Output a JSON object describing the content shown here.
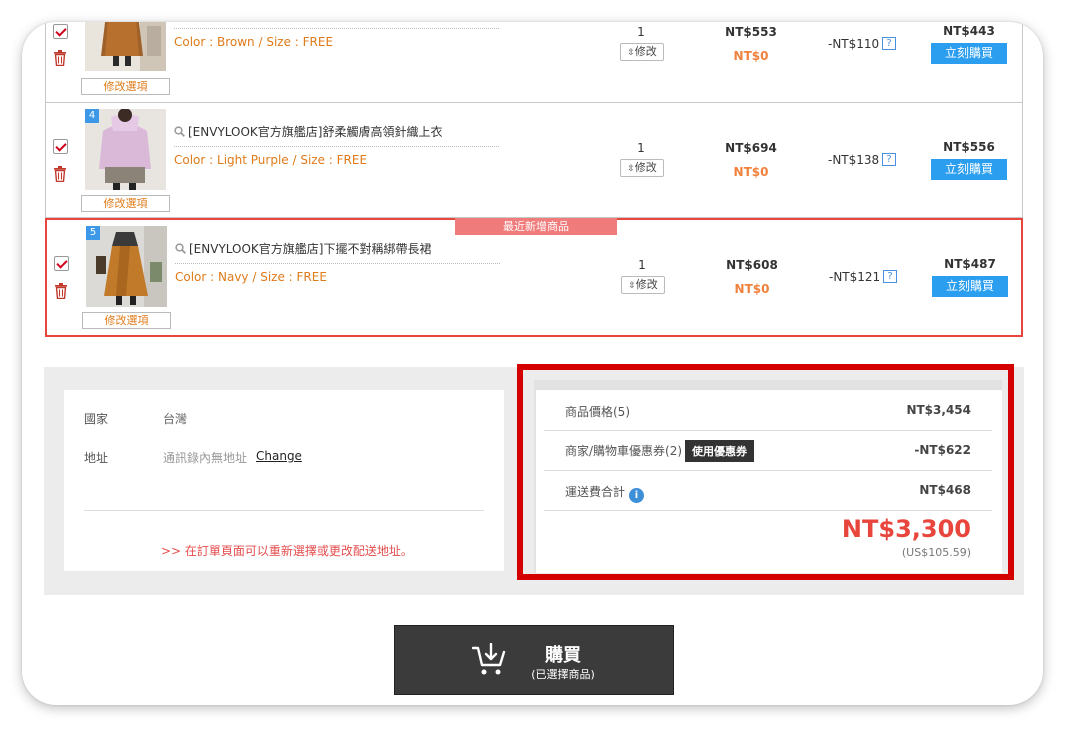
{
  "cart": {
    "items": [
      {
        "color_size": "Color : Brown / Size : FREE",
        "option_button": "修改選項",
        "qty": "1",
        "edit_label": "修改",
        "price": "NT$553",
        "shipping": "NT$0",
        "discount": "-NT$110",
        "help": "?",
        "final": "NT$443",
        "buy_now": "立刻購買"
      },
      {
        "index": "4",
        "name": "[ENVYLOOK官方旗艦店]舒柔觸膚高領針織上衣",
        "color_size": "Color : Light Purple / Size : FREE",
        "option_button": "修改選項",
        "qty": "1",
        "edit_label": "修改",
        "price": "NT$694",
        "shipping": "NT$0",
        "discount": "-NT$138",
        "help": "?",
        "final": "NT$556",
        "buy_now": "立刻購買"
      },
      {
        "index": "5",
        "badge": "最近新增商品",
        "name": "[ENVYLOOK官方旗艦店]下擺不對稱綁帶長裙",
        "color_size": "Color : Navy / Size : FREE",
        "option_button": "修改選項",
        "qty": "1",
        "edit_label": "修改",
        "price": "NT$608",
        "shipping": "NT$0",
        "discount": "-NT$121",
        "help": "?",
        "final": "NT$487",
        "buy_now": "立刻購買"
      }
    ]
  },
  "address": {
    "country_label": "國家",
    "country_value": "台灣",
    "address_label": "地址",
    "address_value": "通訊錄內無地址",
    "change_link": "Change",
    "note": ">> 在訂單頁面可以重新選擇或更改配送地址。"
  },
  "summary": {
    "product_price_label": "商品價格(5)",
    "product_price_value": "NT$3,454",
    "coupon_label": "商家/購物車優惠券(2)",
    "coupon_button": "使用優惠券",
    "coupon_value": "-NT$622",
    "shipping_label": "運送費合計",
    "shipping_info": "i",
    "shipping_value": "NT$468",
    "total": "NT$3,300",
    "total_usd": "(US$105.59)"
  },
  "purchase": {
    "label": "購買",
    "sublabel": "(已選擇商品)"
  },
  "colors": {
    "accent_red": "#e8463c",
    "highlight_frame": "#d40000",
    "buy_blue": "#2b9ef0",
    "option_orange": "#e07b1a",
    "dark_button": "#3b3b3b"
  }
}
